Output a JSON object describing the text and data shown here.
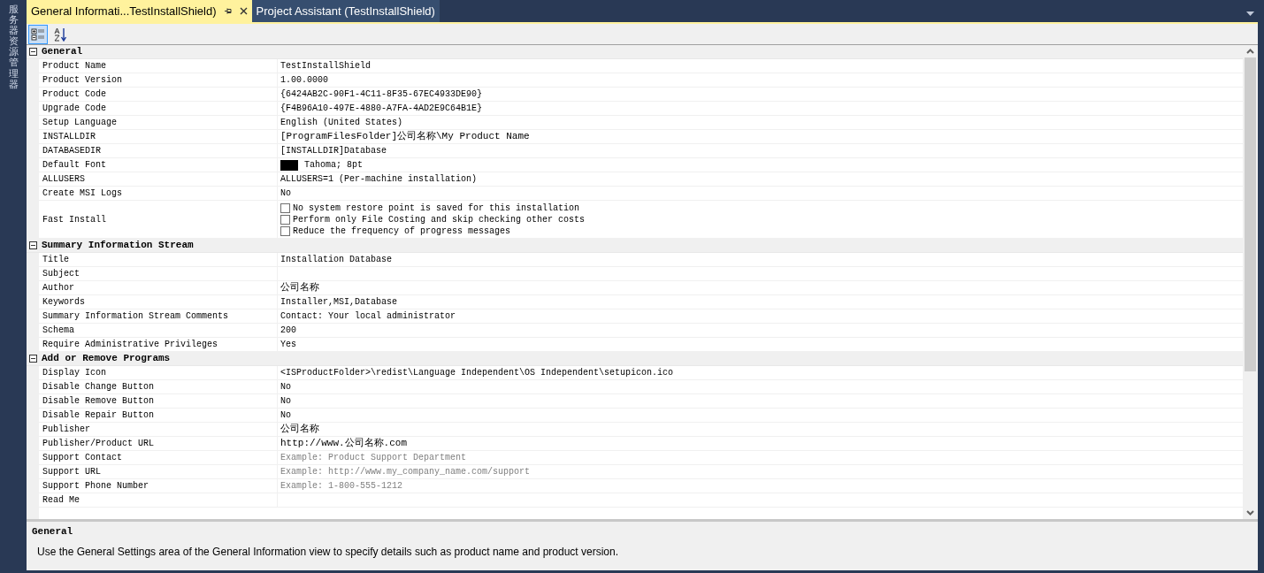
{
  "sidebar": {
    "label": "服务器资源管理器"
  },
  "tabs": [
    {
      "label": "General Informati...TestInstallShield)",
      "selected": true,
      "pinned": true
    },
    {
      "label": "Project Assistant (TestInstallShield)",
      "selected": false,
      "pinned": false
    }
  ],
  "toolbar": [
    {
      "kind": "categorized",
      "selected": true
    },
    {
      "kind": "alphabetical",
      "selected": false
    }
  ],
  "categories": [
    {
      "name": "General",
      "expanded": true,
      "properties": [
        {
          "name": "Product Name",
          "kind": "text",
          "value": "TestInstallShield"
        },
        {
          "name": "Product Version",
          "kind": "text",
          "value": "1.00.0000"
        },
        {
          "name": "Product Code",
          "kind": "text",
          "value": "{6424AB2C-90F1-4C11-8F35-67EC4933DE90}"
        },
        {
          "name": "Upgrade Code",
          "kind": "text",
          "value": "{F4B96A10-497E-4880-A7FA-4AD2E9C64B1E}"
        },
        {
          "name": "Setup Language",
          "kind": "text",
          "value": "English (United States)"
        },
        {
          "name": "INSTALLDIR",
          "kind": "text",
          "value": "[ProgramFilesFolder]公司名称\\My Product Name"
        },
        {
          "name": "DATABASEDIR",
          "kind": "text",
          "value": "[INSTALLDIR]Database"
        },
        {
          "name": "Default Font",
          "kind": "font",
          "value": "Tahoma; 8pt",
          "color": "#000000"
        },
        {
          "name": "ALLUSERS",
          "kind": "text",
          "value": "ALLUSERS=1 (Per-machine installation)"
        },
        {
          "name": "Create MSI Logs",
          "kind": "text",
          "value": "No"
        },
        {
          "name": "Fast Install",
          "kind": "checks",
          "options": [
            {
              "label": "No system restore point is saved for this installation",
              "checked": false
            },
            {
              "label": "Perform only File Costing and skip checking other costs",
              "checked": false
            },
            {
              "label": "Reduce the frequency of progress messages",
              "checked": false
            }
          ]
        }
      ]
    },
    {
      "name": "Summary Information Stream",
      "expanded": true,
      "properties": [
        {
          "name": "Title",
          "kind": "text",
          "value": "Installation Database"
        },
        {
          "name": "Subject",
          "kind": "text"
        },
        {
          "name": "Author",
          "kind": "text",
          "value": "公司名称"
        },
        {
          "name": "Keywords",
          "kind": "text",
          "value": "Installer,MSI,Database"
        },
        {
          "name": "Summary Information Stream Comments",
          "kind": "text",
          "value": "Contact:  Your local administrator"
        },
        {
          "name": "Schema",
          "kind": "text",
          "value": "200"
        },
        {
          "name": "Require Administrative Privileges",
          "kind": "text",
          "value": "Yes"
        }
      ]
    },
    {
      "name": "Add or Remove Programs",
      "expanded": true,
      "properties": [
        {
          "name": "Display Icon",
          "kind": "text",
          "value": "<ISProductFolder>\\redist\\Language Independent\\OS Independent\\setupicon.ico"
        },
        {
          "name": "Disable Change Button",
          "kind": "text",
          "value": "No"
        },
        {
          "name": "Disable Remove Button",
          "kind": "text",
          "value": "No"
        },
        {
          "name": "Disable Repair Button",
          "kind": "text",
          "value": "No"
        },
        {
          "name": "Publisher",
          "kind": "text",
          "value": "公司名称"
        },
        {
          "name": "Publisher/Product URL",
          "kind": "text",
          "value": "http://www.公司名称.com"
        },
        {
          "name": "Support Contact",
          "kind": "text",
          "placeholder": "Example: Product Support Department"
        },
        {
          "name": "Support URL",
          "kind": "text",
          "placeholder": "Example: http://www.my_company_name.com/support"
        },
        {
          "name": "Support Phone Number",
          "kind": "text",
          "placeholder": "Example: 1-800-555-1212"
        },
        {
          "name": "Read Me",
          "kind": "text"
        }
      ]
    }
  ],
  "description": {
    "title": "General",
    "text": "Use the General Settings area of the General Information view to specify details such as product name and product version."
  }
}
